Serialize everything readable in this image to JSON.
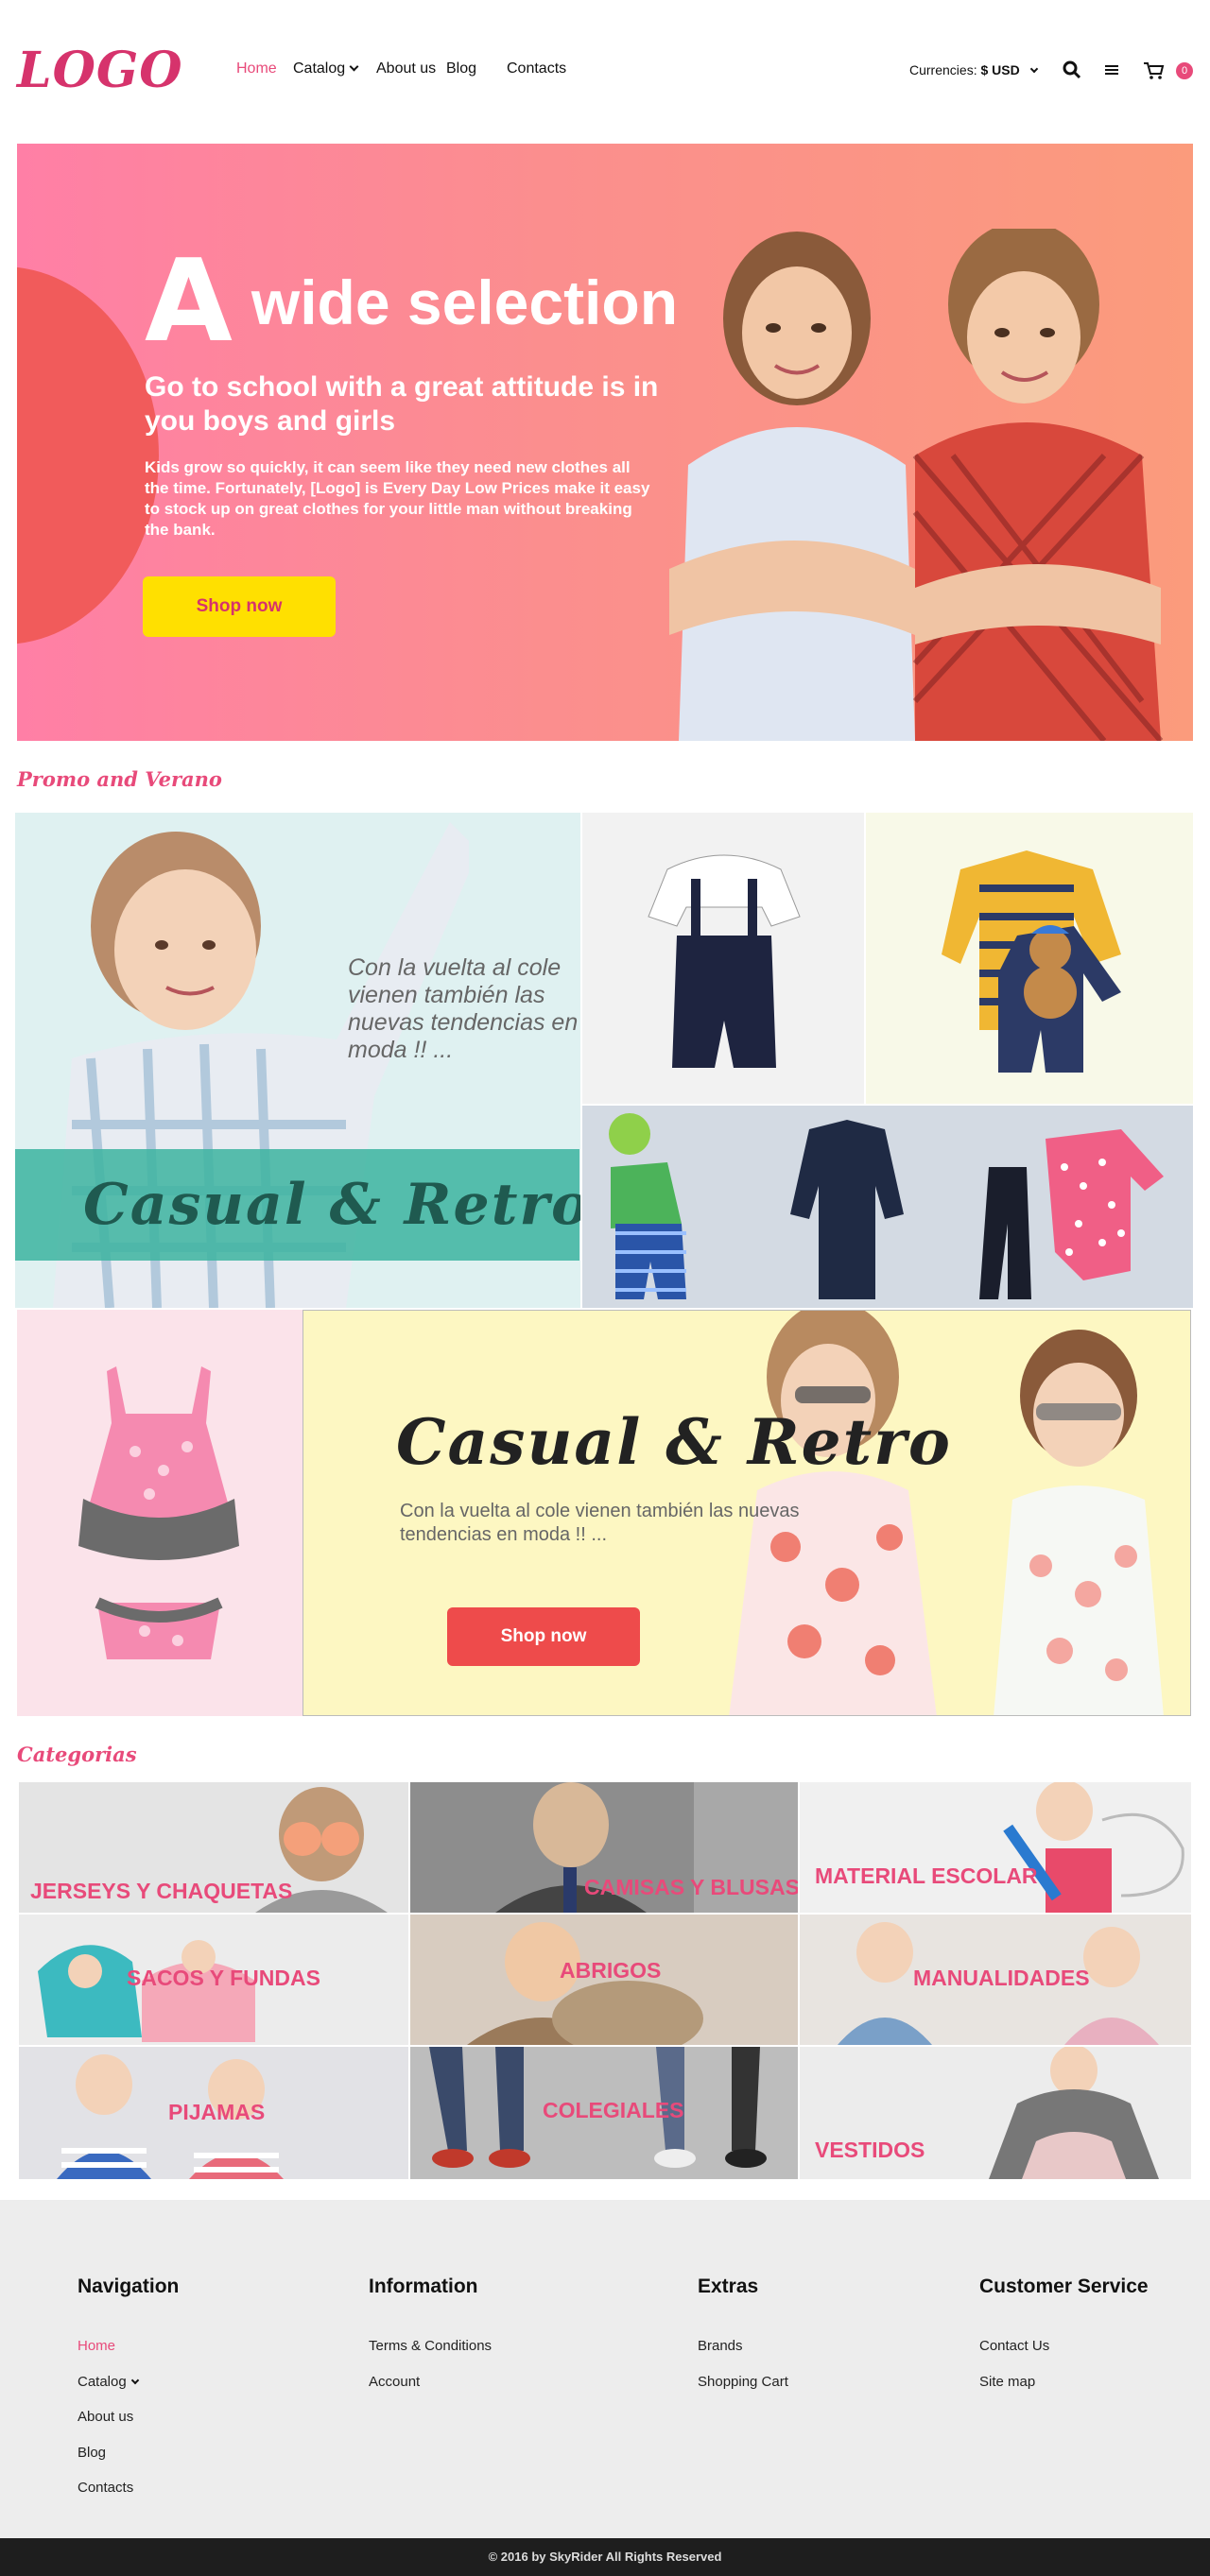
{
  "header": {
    "logo": "LOGO",
    "nav": [
      "Home",
      "Catalog",
      "About us",
      "Blog",
      "Contacts"
    ],
    "currency_label": "Currencies:",
    "currency_value": "$ USD",
    "cart_count": "0",
    "icons": [
      "search-icon",
      "menu-icon",
      "cart-icon"
    ]
  },
  "hero": {
    "title_big": "A",
    "title_rest": "wide  selection",
    "subtitle": "Go to school with a great attitude is in you boys and girls",
    "text": "Kids grow so quickly, it can seem like they need new clothes all the time. Fortunately, [Logo] is Every Day Low Prices make it easy  to stock up on great clothes for your little man without breaking the bank.",
    "button": "Shop now"
  },
  "promo": {
    "title": "Promo and Verano",
    "tile_text": "Con la vuelta al cole vienen también las nuevas tendencias en moda !! ...",
    "band_text": "Casual & Retro",
    "banner_title": "Casual & Retro",
    "banner_text": "Con la vuelta al cole vienen también las nuevas tendencias en moda !! ...",
    "banner_button": "Shop now"
  },
  "categories": {
    "title": "Categorias",
    "items": [
      "JERSEYS Y CHAQUETAS",
      "CAMISAS Y BLUSAS",
      "MATERIAL ESCOLAR",
      "SACOS Y FUNDAS",
      "ABRIGOS",
      "MANUALIDADES",
      "PIJAMAS",
      "COLEGIALES",
      "VESTIDOS"
    ]
  },
  "footer": {
    "navigation": {
      "title": "Navigation",
      "links": [
        "Home",
        "Catalog",
        "About us",
        "Blog",
        "Contacts"
      ]
    },
    "information": {
      "title": "Information",
      "links": [
        "Terms & Conditions",
        "Account"
      ]
    },
    "extras": {
      "title": "Extras",
      "links": [
        "Brands",
        "Shopping Cart"
      ]
    },
    "customer_service": {
      "title": "Customer Service",
      "links": [
        "Contact Us",
        "Site map"
      ]
    },
    "copyright": "© 2016 by SkyRider All Rights Reserved"
  },
  "colors": {
    "accent": "#e84a7a",
    "hero_button": "#ffe000",
    "banner_button": "#ee4b4b",
    "footer_bg": "#ededed",
    "bottom_bar": "#1e1e1e"
  }
}
